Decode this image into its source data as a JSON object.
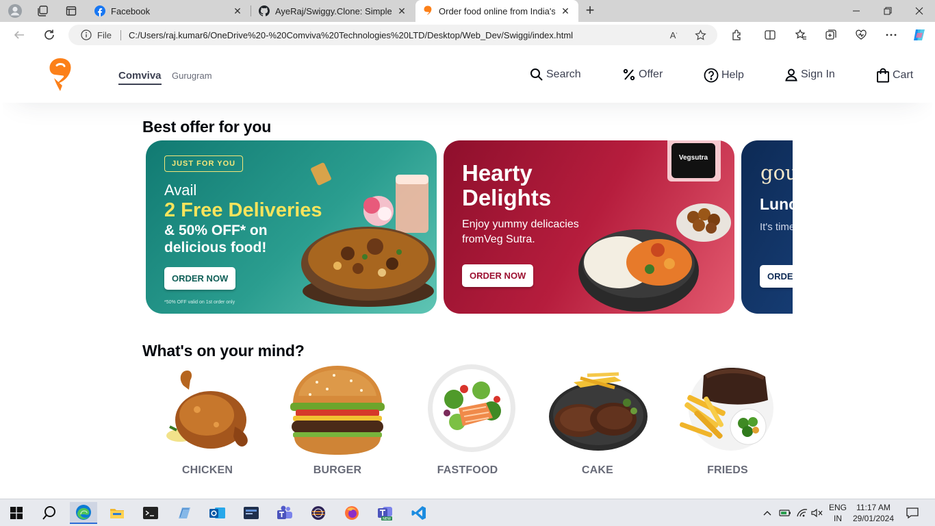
{
  "browser": {
    "tabs": [
      {
        "title": "Facebook",
        "icon": "facebook-icon",
        "active": false
      },
      {
        "title": "AyeRaj/Swiggy.Clone: Simple Fro",
        "icon": "github-icon",
        "active": false
      },
      {
        "title": "Order food online from India's b",
        "icon": "swiggy-icon",
        "active": true
      }
    ],
    "address": {
      "scheme_label": "File",
      "url": "C:/Users/raj.kumar6/OneDrive%20-%20Comviva%20Technologies%20LTD/Desktop/Web_Dev/Swiggi/index.html"
    }
  },
  "site": {
    "brand_color": "#fc8019",
    "location": {
      "city": "Comviva",
      "area": "Gurugram"
    },
    "nav": [
      {
        "label": "Search",
        "icon": "search-icon"
      },
      {
        "label": "Offer",
        "icon": "percent-icon"
      },
      {
        "label": "Help",
        "icon": "help-icon"
      },
      {
        "label": "Sign In",
        "icon": "user-icon"
      },
      {
        "label": "Cart",
        "icon": "bag-icon"
      }
    ],
    "offers_title": "Best offer for you",
    "offers": [
      {
        "badge": "JUST FOR YOU",
        "line1": "Avail",
        "headline": "2 Free Deliveries",
        "sub": "& 50% OFF* on delicious food!",
        "button": "ORDER NOW",
        "fine": "*50% OFF valid on 1st order only"
      },
      {
        "headline": "Hearty Delights",
        "sub": "Enjoy yummy delicacies fromVeg Sutra.",
        "button": "ORDER NOW",
        "logo_text": "Vegsutra"
      },
      {
        "script": "gou",
        "headline": "Lunc",
        "sub": "It's time yourse",
        "button": "ORDE"
      }
    ],
    "mind_title": "What's on your mind?",
    "categories": [
      {
        "label": "CHICKEN",
        "icon": "chicken-image"
      },
      {
        "label": "BURGER",
        "icon": "burger-image"
      },
      {
        "label": "FASTFOOD",
        "icon": "salad-image"
      },
      {
        "label": "CAKE",
        "icon": "steak-image"
      },
      {
        "label": "FRIEDS",
        "icon": "fries-image"
      }
    ]
  },
  "taskbar": {
    "lang": {
      "line1": "ENG",
      "line2": "IN"
    },
    "clock": {
      "time": "11:17 AM",
      "date": "29/01/2024"
    }
  }
}
